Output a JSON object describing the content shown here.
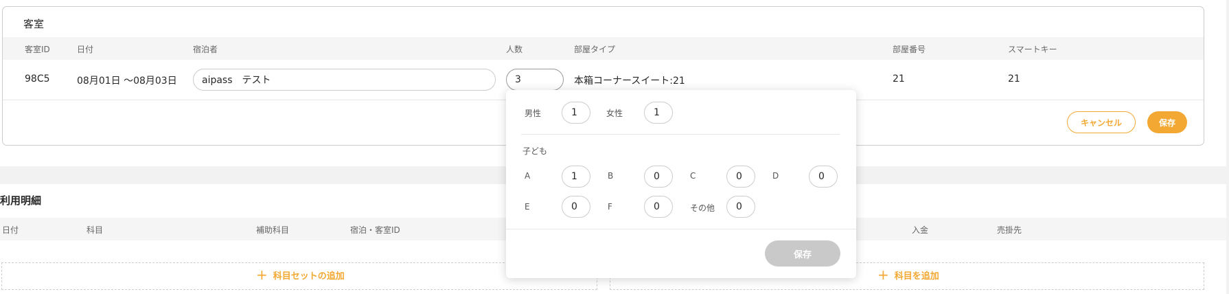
{
  "room_section": {
    "title": "客室",
    "headers": {
      "room_id": "客室ID",
      "date": "日付",
      "guest": "宿泊者",
      "people": "人数",
      "room_type": "部屋タイプ",
      "room_number": "部屋番号",
      "smart_key": "スマートキー"
    },
    "row": {
      "room_id": "98C5",
      "date": "08月01日 〜08月03日",
      "guest": "aipass　テスト",
      "people": "3",
      "room_type": "本箱コーナースイート:21",
      "room_number": "21",
      "smart_key": "21"
    },
    "cancel_label": "キャンセル",
    "save_label": "保存"
  },
  "usage_section": {
    "title": "利用明細",
    "headers": {
      "date": "日付",
      "subject": "科目",
      "sub_subject": "補助科目",
      "stay_room_id": "宿泊・客室ID",
      "deposit": "入金",
      "account": "売掛先"
    },
    "add_set_label": "科目セットの追加",
    "add_subject_label": "科目を追加"
  },
  "guest_popup": {
    "male_label": "男性",
    "male_value": "1",
    "female_label": "女性",
    "female_value": "1",
    "children_label": "子ども",
    "a_label": "A",
    "a_value": "1",
    "b_label": "B",
    "b_value": "0",
    "c_label": "C",
    "c_value": "0",
    "d_label": "D",
    "d_value": "0",
    "e_label": "E",
    "e_value": "0",
    "f_label": "F",
    "f_value": "0",
    "other_label": "その他",
    "other_value": "0",
    "save_label": "保存"
  },
  "colors": {
    "accent": "#f2a832",
    "disabled": "#c9c9c9"
  }
}
